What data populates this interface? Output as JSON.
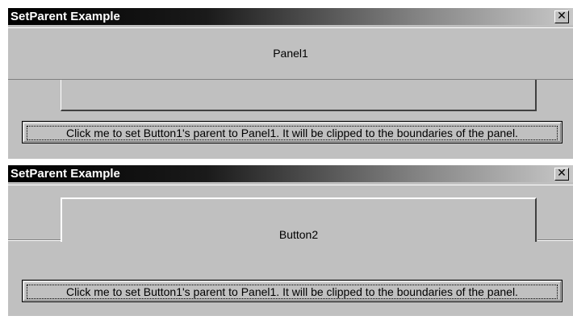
{
  "windows": [
    {
      "title": "SetParent Example",
      "close_glyph": "✕",
      "panel_label": "Panel1",
      "long_button_label": "Click me to set Button1's parent to Panel1. It will be clipped to the boundaries of the panel."
    },
    {
      "title": "SetParent Example",
      "close_glyph": "✕",
      "button2_label": "Button2",
      "long_button_label": "Click me to set Button1's parent to Panel1. It will be clipped to the boundaries of the panel."
    }
  ],
  "icons": {
    "close": "close-icon"
  },
  "colors": {
    "window_face": "#c0c0c0",
    "title_gradient_start": "#000000",
    "title_gradient_end": "#c8c8c8",
    "title_text": "#ffffff"
  }
}
